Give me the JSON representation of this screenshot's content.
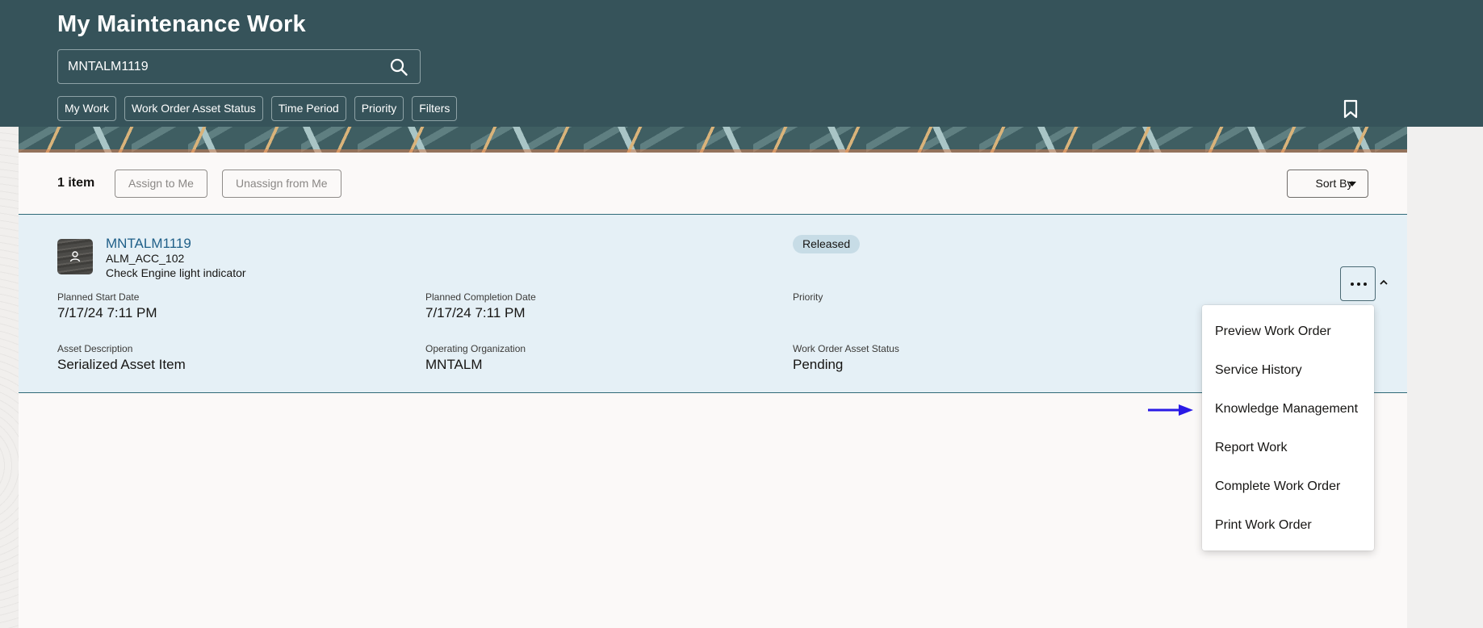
{
  "header": {
    "title": "My Maintenance Work",
    "search": {
      "value": "MNTALM1119",
      "placeholder": ""
    },
    "filter_chips": [
      {
        "label": "My Work"
      },
      {
        "label": "Work Order Asset Status"
      },
      {
        "label": "Time Period"
      },
      {
        "label": "Priority"
      },
      {
        "label": "Filters"
      }
    ]
  },
  "toolbar": {
    "count_label": "1 item",
    "assign_label": "Assign to Me",
    "unassign_label": "Unassign from Me",
    "sort_label": "Sort By"
  },
  "work_order": {
    "number": "MNTALM1119",
    "asset": "ALM_ACC_102",
    "description": "Check Engine light indicator",
    "status_badge": "Released",
    "fields": [
      {
        "label": "Planned Start Date",
        "value": "7/17/24 7:11 PM"
      },
      {
        "label": "Planned Completion Date",
        "value": "7/17/24 7:11 PM"
      },
      {
        "label": "Priority",
        "value": ""
      },
      {
        "label": "Asset Description",
        "value": "Serialized Asset Item"
      },
      {
        "label": "Operating Organization",
        "value": "MNTALM"
      },
      {
        "label": "Work Order Asset Status",
        "value": "Pending"
      }
    ]
  },
  "actions_menu": {
    "items": [
      {
        "label": "Preview Work Order"
      },
      {
        "label": "Service History"
      },
      {
        "label": "Knowledge Management"
      },
      {
        "label": "Report Work"
      },
      {
        "label": "Complete Work Order"
      },
      {
        "label": "Print Work Order"
      }
    ]
  },
  "colors": {
    "header_bg": "#36535a",
    "card_bg": "#e5f0f6",
    "link": "#1f5f88",
    "annotation_arrow": "#2a1ae6"
  }
}
